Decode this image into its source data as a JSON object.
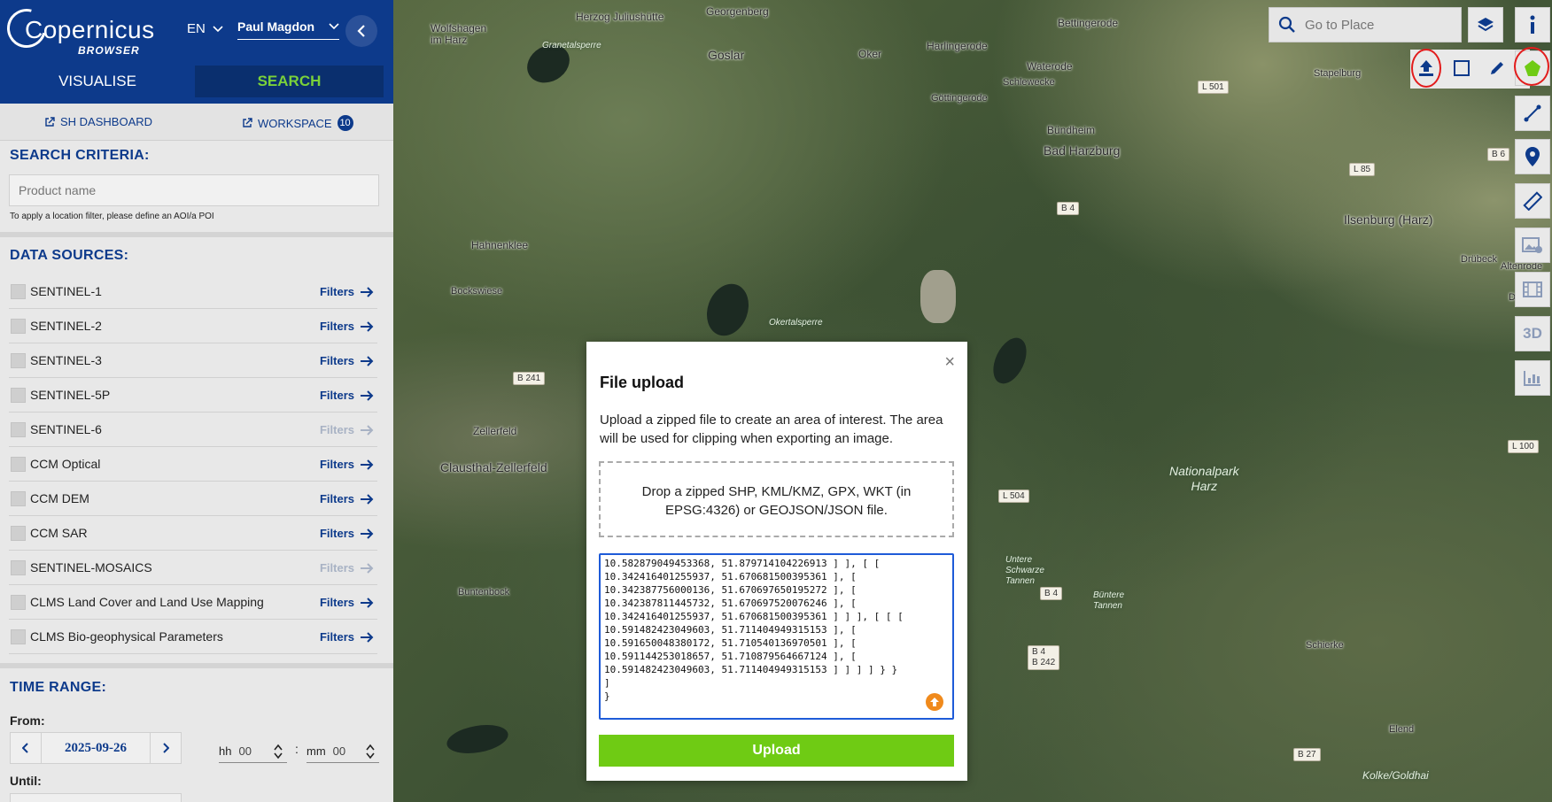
{
  "header": {
    "logo_text": "Copernicus",
    "logo_sub": "BROWSER",
    "language": "EN",
    "user_name": "Paul Magdon",
    "tabs": [
      "VISUALISE",
      "SEARCH"
    ],
    "active_tab": "SEARCH"
  },
  "links": {
    "dashboard": "SH DASHBOARD",
    "workspace": "WORKSPACE",
    "workspace_count": "10"
  },
  "search": {
    "criteria_title": "SEARCH CRITERIA:",
    "product_placeholder": "Product name",
    "hint": "To apply a location filter, please define an AOI/a POI"
  },
  "data_sources": {
    "title": "DATA SOURCES:",
    "filters_label": "Filters",
    "items": [
      {
        "name": "SENTINEL-1",
        "filters_enabled": true
      },
      {
        "name": "SENTINEL-2",
        "filters_enabled": true
      },
      {
        "name": "SENTINEL-3",
        "filters_enabled": true
      },
      {
        "name": "SENTINEL-5P",
        "filters_enabled": true
      },
      {
        "name": "SENTINEL-6",
        "filters_enabled": false
      },
      {
        "name": "CCM Optical",
        "filters_enabled": true
      },
      {
        "name": "CCM DEM",
        "filters_enabled": true
      },
      {
        "name": "CCM SAR",
        "filters_enabled": true
      },
      {
        "name": "SENTINEL-MOSAICS",
        "filters_enabled": false
      },
      {
        "name": "CLMS Land Cover and Land Use Mapping",
        "filters_enabled": true
      },
      {
        "name": "CLMS Bio-geophysical Parameters",
        "filters_enabled": true
      }
    ]
  },
  "time_range": {
    "title": "TIME RANGE:",
    "from_label": "From:",
    "from_date": "2025-09-26",
    "hh_label": "hh",
    "hh_value": "00",
    "separator": ":",
    "mm_label": "mm",
    "mm_value": "00",
    "until_label": "Until:"
  },
  "map": {
    "search_placeholder": "Go to Place",
    "tool_3d": "3D",
    "places": {
      "wolfshagen": "Wolfshagen\nim Harz",
      "herzog": "Herzog Juliushütte",
      "georgenberg": "Georgenberg",
      "bettingerode": "Bettingerode",
      "granetalsperre": "Granetalsperre",
      "goslar": "Goslar",
      "oker": "Oker",
      "harlingerode": "Harlingerode",
      "waterode": "Waterode",
      "stapelburg": "Stapelburg",
      "schlewecke": "Schlewecke",
      "gottingerode": "Göttingerode",
      "bundheim": "Bündheim",
      "bad_harzburg": "Bad Harzburg",
      "ilsenburg": "Ilsenburg (Harz)",
      "drubeck": "Drübeck",
      "altenrode": "Altenrode",
      "darlingerode": "Darling",
      "hahnenklee": "Hahnenklee",
      "bockswiese": "Bockswiese",
      "okertalsperre": "Okertalsperre",
      "zellerfeld": "Zellerfeld",
      "clausthal": "Clausthal-Zellerfeld",
      "nationalpark": "Nationalpark\nHarz",
      "untere": "Untere\nSchwarze\nTannen",
      "buntenbock": "Buntenbock",
      "buntere": "Büntere\nTannen",
      "schierke": "Schierke",
      "elend": "Elend",
      "kolke": "Kolke/Goldhai"
    },
    "roads": [
      "L 501",
      "B 6",
      "L 85",
      "B 4",
      "B 241",
      "L 504",
      "B 4",
      "B 4\nB 242",
      "L 100",
      "B 27"
    ]
  },
  "modal": {
    "title": "File upload",
    "close": "×",
    "description": "Upload a zipped file to create an area of interest. The area will be used for clipping when exporting an image.",
    "dropzone": "Drop a zipped SHP, KML/KMZ, GPX, WKT (in EPSG:4326) or GEOJSON/JSON file.",
    "textarea_lines": [
      "10.582879049453368, 51.879714104226913 ] ], [ [",
      "10.342416401255937, 51.670681500395361 ], [",
      "10.342387756000136, 51.670697650195272 ], [",
      "10.342387811445732, 51.670697520076246 ], [",
      "10.342416401255937, 51.670681500395361 ] ] ], [ [ [",
      "10.591482423049603, 51.711404949315153 ], [",
      "10.591650048380172, 51.710540136970501 ], [",
      "10.591144253018657, 51.710879564667124 ], [",
      "10.591482423049603, 51.711404949315153 ] ] ] ] } }",
      "]",
      "}",
      ""
    ],
    "upload_label": "Upload"
  },
  "colors": {
    "header_bg": "#0d3a8b",
    "active_tab_text": "#7ad13a",
    "upload_button": "#6fcb14",
    "textarea_border": "#1e5bd8",
    "highlight_circle": "#e21c1c"
  }
}
